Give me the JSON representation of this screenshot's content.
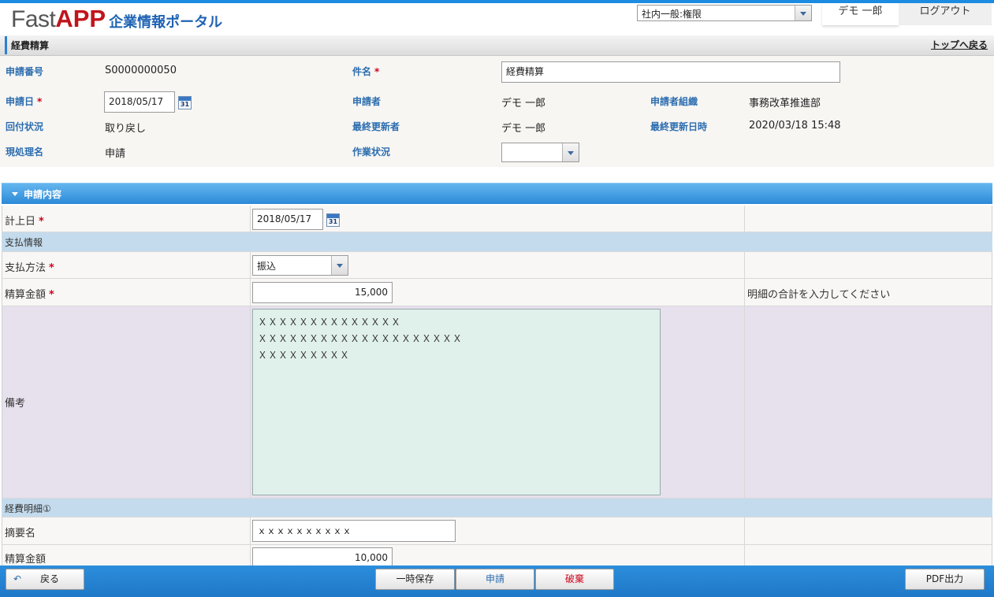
{
  "app": {
    "logo_fast": "Fast",
    "logo_app": "APP",
    "portal_name": "企業情報ポータル"
  },
  "header_bar": {
    "role_select": "社内一般:権限",
    "user_name": "デモ 一郎",
    "logout_label": "ログアウト"
  },
  "page": {
    "title": "経費精算",
    "top_link": "トップへ戻る"
  },
  "summary": {
    "app_no_label": "申請番号",
    "app_no": "S0000000050",
    "subject_label": "件名",
    "subject": "経費精算",
    "app_date_label": "申請日",
    "app_date": "2018/05/17",
    "applicant_label": "申請者",
    "applicant": "デモ 一郎",
    "org_label": "申請者組織",
    "org": "事務改革推進部",
    "route_label": "回付状況",
    "route": "取り戻し",
    "updater_label": "最終更新者",
    "updater": "デモ 一郎",
    "updated_at_label": "最終更新日時",
    "updated_at": "2020/03/18 15:48",
    "process_label": "現処理名",
    "process": "申請",
    "work_label": "作業状況",
    "work": "",
    "required_mark": "*",
    "cal_day": "31"
  },
  "section": {
    "title": "申請内容",
    "posting_date_label": "計上日",
    "posting_date": "2018/05/17",
    "payment_group": "支払情報",
    "pay_method_label": "支払方法",
    "pay_method": "振込",
    "amount_label": "精算金額",
    "amount": "15,000",
    "amount_hint": "明細の合計を入力してください",
    "remarks_label": "備考",
    "remarks": "ＸＸＸＸＸＸＸＸＸＸＸＸＸＸ\nＸＸＸＸＸＸＸＸＸＸＸＸＸＸＸＸＸＸＸＸ\nＸＸＸＸＸＸＸＸＸ",
    "detail_group": "経費明細①",
    "item_label": "摘要名",
    "item": "ｘｘｘｘｘｘｘｘｘｘ",
    "detail_amount_label": "精算金額",
    "detail_amount": "10,000"
  },
  "footer": {
    "back": "戻る",
    "save": "一時保存",
    "apply": "申請",
    "discard": "破棄",
    "pdf": "PDF出力"
  },
  "colors": {
    "accent": "#1c8ce3",
    "required": "#d0021b",
    "label_blue": "#2c6daf",
    "brand_red": "#c0141c"
  }
}
